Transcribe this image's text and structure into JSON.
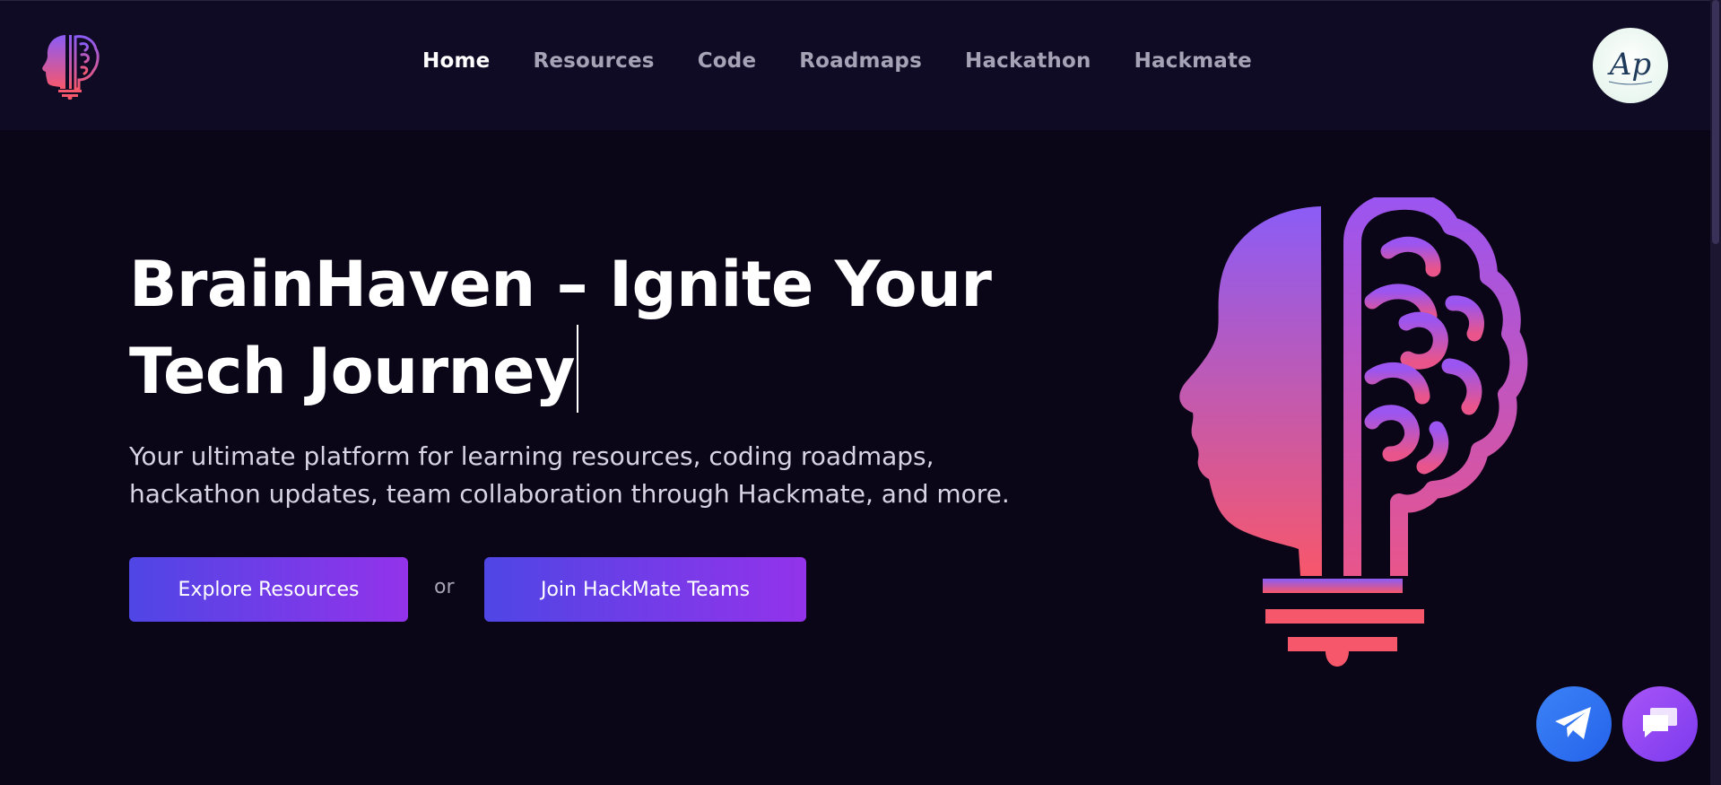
{
  "navbar": {
    "logo_icon": "brain-head-logo-icon",
    "links": [
      {
        "label": "Home",
        "active": true
      },
      {
        "label": "Resources",
        "active": false
      },
      {
        "label": "Code",
        "active": false
      },
      {
        "label": "Roadmaps",
        "active": false
      },
      {
        "label": "Hackathon",
        "active": false
      },
      {
        "label": "Hackmate",
        "active": false
      }
    ],
    "avatar_initials": "Ap"
  },
  "hero": {
    "title_line1": "BrainHaven – Ignite Your",
    "title_line2": "Tech Journey",
    "subtitle_line1": "Your ultimate platform for learning resources, coding roadmaps,",
    "subtitle_line2": "hackathon updates, team collaboration through Hackmate, and more.",
    "primary_button": "Explore Resources",
    "separator": "or",
    "secondary_button": "Join HackMate Teams",
    "illustration_icon": "brain-head-lightbulb-icon"
  },
  "floating_buttons": {
    "telegram_icon": "telegram-icon",
    "chat_icon": "chat-icon"
  },
  "colors": {
    "background": "#0b0617",
    "navbar": "#100b25",
    "button_gradient_start": "#4f46e5",
    "button_gradient_end": "#9333ea",
    "illustration_top": "#8b5cf6",
    "illustration_bottom": "#f7576b"
  }
}
